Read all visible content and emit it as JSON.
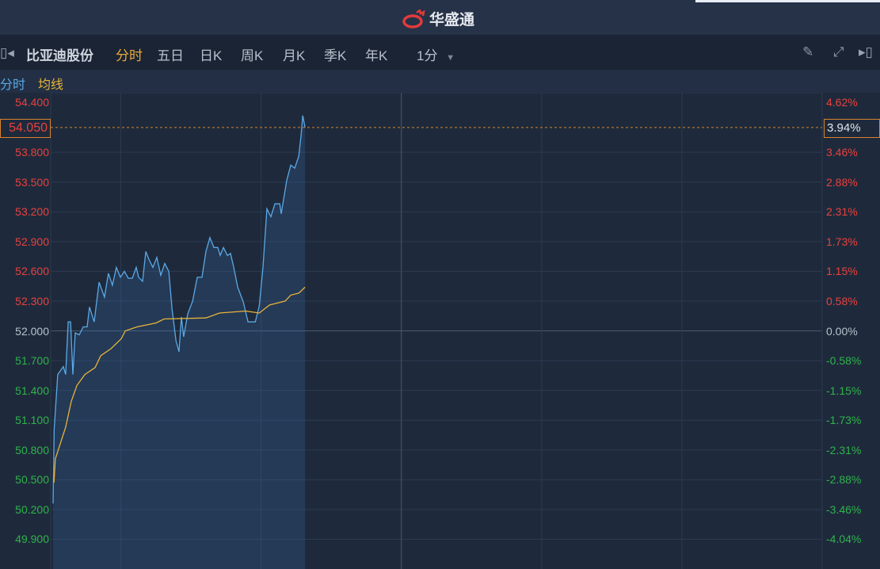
{
  "app": {
    "brand": "华盛通"
  },
  "toolbar": {
    "stock_name": "比亚迪股份",
    "tabs": [
      "分时",
      "五日",
      "日K",
      "周K",
      "月K",
      "季K",
      "年K"
    ],
    "active_tab": "分时",
    "interval": "1分"
  },
  "legend": {
    "price_label": "分时",
    "avg_label": "均线"
  },
  "colors": {
    "price": "#5aa9e6",
    "avg": "#e8b33a",
    "up": "#e8413c",
    "down": "#2fb34a",
    "current": "#d9822b"
  },
  "current": {
    "price": "54.050",
    "pct": "3.94%"
  },
  "chart_data": {
    "type": "line",
    "prev_close": 52.0,
    "ylim": [
      49.6,
      54.4
    ],
    "x_range_minutes": [
      0,
      330
    ],
    "vertical_grid_minutes": [
      30,
      90,
      150,
      210,
      270
    ],
    "left_ticks": [
      {
        "v": 54.4,
        "t": "54.400"
      },
      {
        "v": 53.8,
        "t": "53.800"
      },
      {
        "v": 53.5,
        "t": "53.500"
      },
      {
        "v": 53.2,
        "t": "53.200"
      },
      {
        "v": 52.9,
        "t": "52.900"
      },
      {
        "v": 52.6,
        "t": "52.600"
      },
      {
        "v": 52.3,
        "t": "52.300"
      },
      {
        "v": 52.0,
        "t": "52.000"
      },
      {
        "v": 51.7,
        "t": "51.700"
      },
      {
        "v": 51.4,
        "t": "51.400"
      },
      {
        "v": 51.1,
        "t": "51.100"
      },
      {
        "v": 50.8,
        "t": "50.800"
      },
      {
        "v": 50.5,
        "t": "50.500"
      },
      {
        "v": 50.2,
        "t": "50.200"
      },
      {
        "v": 49.9,
        "t": "49.900"
      }
    ],
    "right_ticks": [
      {
        "v": 54.4,
        "t": "4.62%"
      },
      {
        "v": 53.8,
        "t": "3.46%"
      },
      {
        "v": 53.5,
        "t": "2.88%"
      },
      {
        "v": 53.2,
        "t": "2.31%"
      },
      {
        "v": 52.9,
        "t": "1.73%"
      },
      {
        "v": 52.6,
        "t": "1.15%"
      },
      {
        "v": 52.3,
        "t": "0.58%"
      },
      {
        "v": 52.0,
        "t": "0.00%"
      },
      {
        "v": 51.7,
        "t": "-0.58%"
      },
      {
        "v": 51.4,
        "t": "-1.15%"
      },
      {
        "v": 51.1,
        "t": "-1.73%"
      },
      {
        "v": 50.8,
        "t": "-2.31%"
      },
      {
        "v": 50.5,
        "t": "-2.88%"
      },
      {
        "v": 50.2,
        "t": "-3.46%"
      },
      {
        "v": 49.9,
        "t": "-4.04%"
      }
    ],
    "series": [
      {
        "name": "分时",
        "points": [
          [
            1,
            50.26
          ],
          [
            1.5,
            51.01
          ],
          [
            3,
            51.56
          ],
          [
            5.4,
            51.64
          ],
          [
            6.4,
            51.56
          ],
          [
            7.5,
            52.09
          ],
          [
            8.5,
            52.09
          ],
          [
            9.5,
            51.56
          ],
          [
            10.5,
            51.98
          ],
          [
            12.2,
            51.96
          ],
          [
            13.9,
            52.04
          ],
          [
            15.6,
            52.04
          ],
          [
            16.6,
            52.24
          ],
          [
            18.6,
            52.09
          ],
          [
            20.7,
            52.49
          ],
          [
            23,
            52.34
          ],
          [
            24.7,
            52.58
          ],
          [
            26.4,
            52.46
          ],
          [
            28.1,
            52.64
          ],
          [
            29.8,
            52.54
          ],
          [
            31.5,
            52.6
          ],
          [
            33.2,
            52.53
          ],
          [
            34.9,
            52.53
          ],
          [
            36.6,
            52.64
          ],
          [
            37.6,
            52.54
          ],
          [
            39.3,
            52.5
          ],
          [
            40.7,
            52.8
          ],
          [
            42,
            52.72
          ],
          [
            43.7,
            52.64
          ],
          [
            45.4,
            52.74
          ],
          [
            47.1,
            52.56
          ],
          [
            48.8,
            52.68
          ],
          [
            50.5,
            52.6
          ],
          [
            51.9,
            52.22
          ],
          [
            53.6,
            51.9
          ],
          [
            54.9,
            51.79
          ],
          [
            55.9,
            52.14
          ],
          [
            56.9,
            51.94
          ],
          [
            58.6,
            52.17
          ],
          [
            60.7,
            52.3
          ],
          [
            62.7,
            52.54
          ],
          [
            64.7,
            52.54
          ],
          [
            66.4,
            52.8
          ],
          [
            68.1,
            52.94
          ],
          [
            69.8,
            52.84
          ],
          [
            71.5,
            52.84
          ],
          [
            72.5,
            52.76
          ],
          [
            73.9,
            52.84
          ],
          [
            75.6,
            52.76
          ],
          [
            76.9,
            52.78
          ],
          [
            78.3,
            52.64
          ],
          [
            80,
            52.44
          ],
          [
            82.4,
            52.29
          ],
          [
            84.4,
            52.09
          ],
          [
            87.5,
            52.09
          ],
          [
            89.2,
            52.25
          ],
          [
            90.8,
            52.64
          ],
          [
            92.5,
            53.23
          ],
          [
            94.2,
            53.15
          ],
          [
            95.9,
            53.28
          ],
          [
            98,
            53.28
          ],
          [
            98.6,
            53.18
          ],
          [
            101,
            53.52
          ],
          [
            102.7,
            53.67
          ],
          [
            104.4,
            53.64
          ],
          [
            106.1,
            53.76
          ],
          [
            107.1,
            53.97
          ],
          [
            107.8,
            54.17
          ],
          [
            108.8,
            54.05
          ]
        ]
      },
      {
        "name": "均线",
        "points": [
          [
            1.4,
            50.47
          ],
          [
            2,
            50.71
          ],
          [
            6.4,
            51.03
          ],
          [
            8.8,
            51.29
          ],
          [
            11.2,
            51.45
          ],
          [
            14.6,
            51.56
          ],
          [
            19,
            51.63
          ],
          [
            21.4,
            51.75
          ],
          [
            25.8,
            51.82
          ],
          [
            30.2,
            51.92
          ],
          [
            31.9,
            52.0
          ],
          [
            36.9,
            52.04
          ],
          [
            45.1,
            52.08
          ],
          [
            48.5,
            52.12
          ],
          [
            66.4,
            52.13
          ],
          [
            72.2,
            52.18
          ],
          [
            83.4,
            52.2
          ],
          [
            89.2,
            52.18
          ],
          [
            93.6,
            52.26
          ],
          [
            100.3,
            52.3
          ],
          [
            102.7,
            52.36
          ],
          [
            106.1,
            52.38
          ],
          [
            108.8,
            52.44
          ]
        ]
      }
    ]
  }
}
